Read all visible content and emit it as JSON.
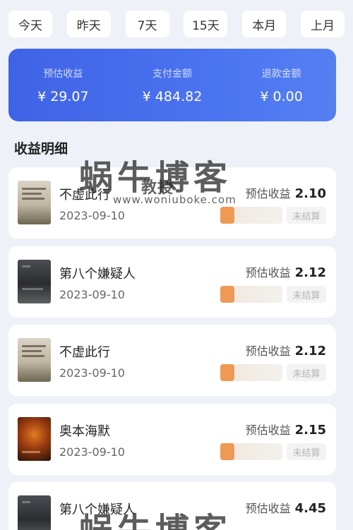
{
  "tabs": [
    "今天",
    "昨天",
    "7天",
    "15天",
    "本月",
    "上月"
  ],
  "summary": {
    "estimated": {
      "label": "预估收益",
      "value": "¥ 29.07"
    },
    "paid": {
      "label": "支付金额",
      "value": "¥ 484.82"
    },
    "refund": {
      "label": "退款金额",
      "value": "¥ 0.00"
    }
  },
  "section_title": "收益明细",
  "earn_label": "预估收益",
  "items": [
    {
      "title": "不虚此行",
      "date": "2023-09-10",
      "amount": "2.10",
      "status": "未结算",
      "cover": "light"
    },
    {
      "title": "第八个嫌疑人",
      "date": "2023-09-10",
      "amount": "2.12",
      "status": "未结算",
      "cover": "dark"
    },
    {
      "title": "不虚此行",
      "date": "2023-09-10",
      "amount": "2.12",
      "status": "未结算",
      "cover": "light"
    },
    {
      "title": "奥本海默",
      "date": "2023-09-10",
      "amount": "2.15",
      "status": "未结算",
      "cover": "fire"
    },
    {
      "title": "第八个嫌疑人",
      "date": "",
      "amount": "4.45",
      "status": "",
      "cover": "dark"
    }
  ],
  "watermark": {
    "main": "蜗牛博客",
    "mid": "教授",
    "url": "www.woniuboke.com"
  },
  "colors": {
    "summary_bg": "#4a6cf0",
    "page_bg": "#eef1f7",
    "tag_accent": "#ee9a55"
  }
}
